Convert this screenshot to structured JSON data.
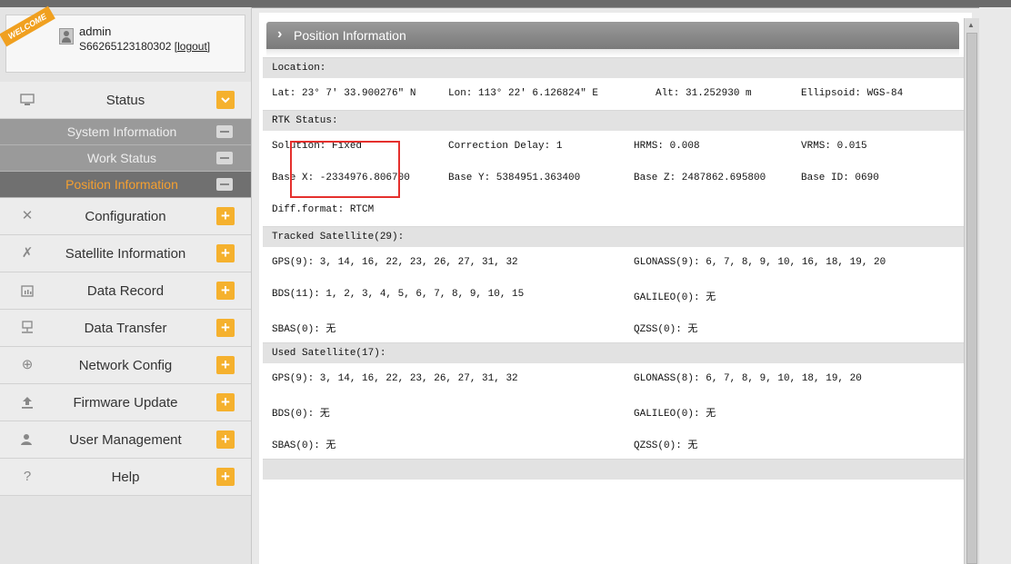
{
  "user": {
    "ribbon": "WELCOME",
    "name": "admin",
    "serial": "S66265123180302",
    "logout": "[logout]"
  },
  "nav": {
    "status": "Status",
    "sub": [
      "System Information",
      "Work Status",
      "Position Information"
    ],
    "items": [
      {
        "label": "Configuration",
        "icon": "tools-icon"
      },
      {
        "label": "Satellite Information",
        "icon": "satellite-icon"
      },
      {
        "label": "Data Record",
        "icon": "calendar-icon"
      },
      {
        "label": "Data Transfer",
        "icon": "network-icon"
      },
      {
        "label": "Network Config",
        "icon": "globe-icon"
      },
      {
        "label": "Firmware Update",
        "icon": "upload-icon"
      },
      {
        "label": "User Management",
        "icon": "user-icon"
      },
      {
        "label": "Help",
        "icon": "question-icon"
      }
    ]
  },
  "page": {
    "title": "Position Information",
    "location_header": "Location:",
    "lat": "Lat: 23° 7′ 33.900276″ N",
    "lon": "Lon: 113° 22′ 6.126824″ E",
    "alt": "Alt: 31.252930 m",
    "ellipsoid": "Ellipsoid: WGS-84",
    "rtk_header": "RTK Status:",
    "solution": "Solution: Fixed",
    "correction_delay": "Correction Delay: 1",
    "hrms": "HRMS: 0.008",
    "vrms": "VRMS: 0.015",
    "base_x": "Base X: -2334976.806700",
    "base_y": "Base Y: 5384951.363400",
    "base_z": "Base Z: 2487862.695800",
    "base_id": "Base ID: 0690",
    "diff_format": "Diff.format: RTCM",
    "tracked_header": "Tracked Satellite(29):",
    "tracked_gps": "GPS(9): 3, 14, 16, 22, 23, 26, 27, 31, 32",
    "tracked_glonass": "GLONASS(9): 6, 7, 8, 9, 10, 16, 18, 19, 20",
    "tracked_bds": "BDS(11): 1, 2, 3, 4, 5, 6, 7, 8, 9, 10, 15",
    "tracked_galileo": "GALILEO(0): 无",
    "tracked_sbas": "SBAS(0): 无",
    "tracked_qzss": "QZSS(0): 无",
    "used_header": "Used Satellite(17):",
    "used_gps": "GPS(9): 3, 14, 16, 22, 23, 26, 27, 31, 32",
    "used_glonass": "GLONASS(8): 6, 7, 8, 9, 10, 18, 19, 20",
    "used_bds": "BDS(0): 无",
    "used_galileo": "GALILEO(0): 无",
    "used_sbas": "SBAS(0): 无",
    "used_qzss": "QZSS(0): 无"
  }
}
